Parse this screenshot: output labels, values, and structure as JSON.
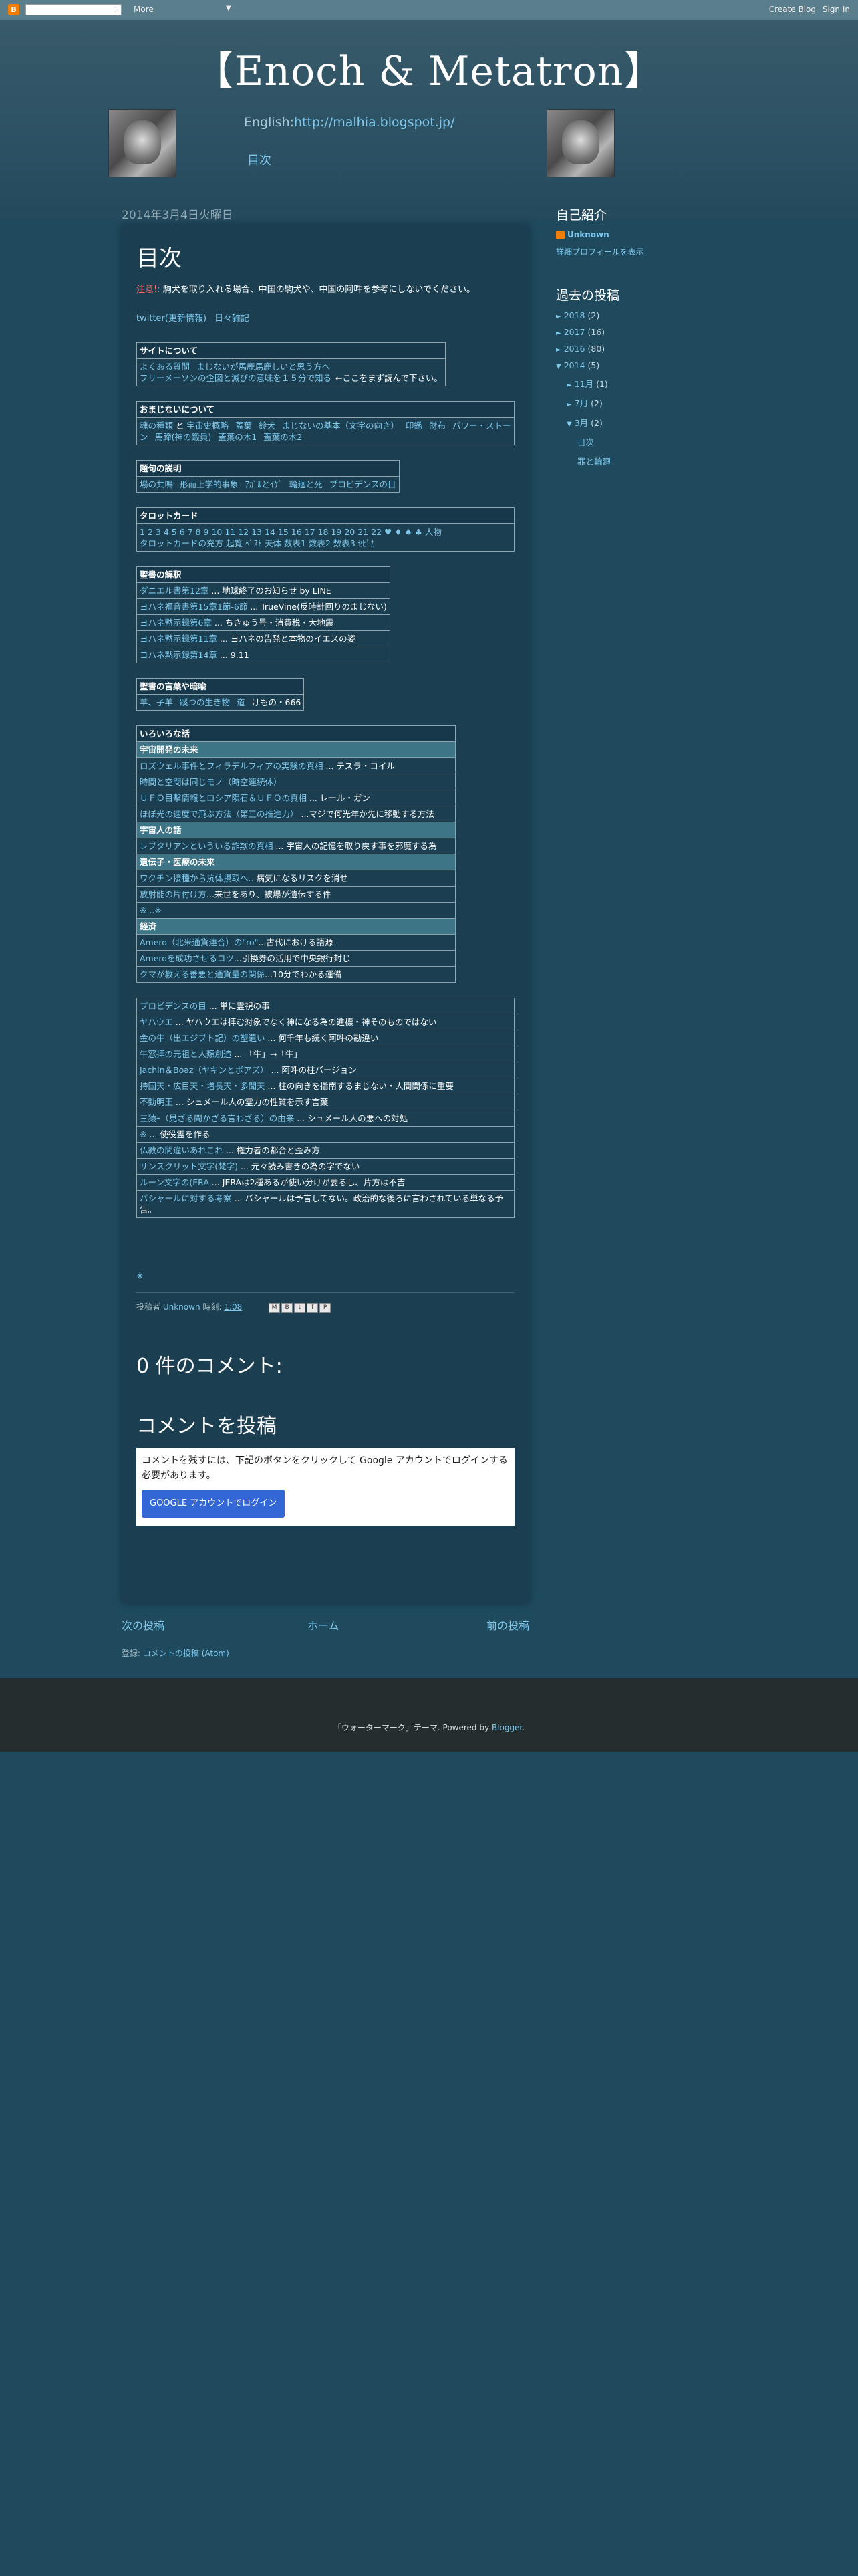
{
  "navbar": {
    "logo": "B",
    "more": "More",
    "create_blog": "Create Blog",
    "sign_in": "Sign In"
  },
  "header": {
    "title": "【Enoch & Metatron】",
    "english_label": "English:",
    "english_url": "http://malhia.blogspot.jp/",
    "toc_link": "目次"
  },
  "post": {
    "date": "2014年3月4日火曜日",
    "title": "目次",
    "note_label": "注意!:",
    "note_text": "駒犬を取り入れる場合、中国の駒犬や、中国の阿吽を参考にしないでください。",
    "twitter": [
      "twitter(更新情報)",
      "日々雑記"
    ],
    "sections": {
      "site": {
        "header": "サイトについて",
        "row1": [
          "よくある質問",
          "まじないが馬鹿馬鹿しいと思う方へ"
        ],
        "row2_link": "フリーメーソンの企図と滅びの意味を１５分で知る",
        "row2_text": "←ここをまず読んで下さい。"
      },
      "majinai": {
        "header": "おまじないについて",
        "row1": [
          "魂の種類",
          "と",
          "宇宙史概略",
          "蓋葉",
          "鈴犬",
          "まじないの基本（文字の向き）",
          "印鑑",
          "財布",
          "パワー・ストーン",
          "馬蹄(神の鍛員)",
          "蓋葉の木1",
          "蓋葉の木2"
        ]
      },
      "setsumei": {
        "header": "題句の説明",
        "row1": [
          "場の共鳴",
          "形而上学的事象",
          "ｱｶﾞﾙとｲｹﾞ",
          "輪廻と死",
          "プロビデンスの目"
        ]
      },
      "tarot": {
        "header": "タロットカード",
        "numbers": [
          "1",
          "2",
          "3",
          "4",
          "5",
          "6",
          "7",
          "8",
          "9",
          "10",
          "11",
          "12",
          "13",
          "14",
          "15",
          "16",
          "17",
          "18",
          "19",
          "20",
          "21",
          "22",
          "♥",
          "♦",
          "♠",
          "♣",
          "人物"
        ],
        "row2": [
          "タロットカードの充方",
          "起覧",
          "ﾍﾞｽﾄ",
          "天体",
          "数表1",
          "数表2",
          "数表3",
          "ｾﾋﾟｶ"
        ]
      },
      "bible": {
        "header": "聖書の解釈",
        "rows": [
          {
            "link": "ダニエル書第12章",
            "text": " ... 地球終了のお知らせ by LINE"
          },
          {
            "link": "ヨハネ福音書第15章1節-6節",
            "text": " ... TrueVine(反時計回りのまじない)"
          },
          {
            "link": "ヨハネ黙示録第6章",
            "text": " ... ちきゅう号・消費税・大地震"
          },
          {
            "link": "ヨハネ黙示録第11章",
            "text": " ... ヨハネの告発と本物のイエスの姿"
          },
          {
            "link": "ヨハネ黙示録第14章",
            "text": " ... 9.11"
          }
        ]
      },
      "words": {
        "header": "聖書の言葉や暗喩",
        "row1": [
          "羊、子羊",
          "蹊つの生き物",
          "道"
        ],
        "row1_text": "けもの・666"
      },
      "topics": {
        "header": "いろいろな話",
        "sub1": "宇宙開発の未来",
        "rows1": [
          {
            "link": "ロズウェル事件とフィラデルフィアの実験の真相",
            "text": " ... テスラ・コイル"
          },
          {
            "link": "時間と空間は同じモノ（時空連続体）",
            "text": ""
          },
          {
            "link": "ＵＦＯ目撃情報とロシア隕石＆ＵＦＯの真相",
            "text": " ... レール・ガン"
          },
          {
            "link": "ほぼ光の速度で飛ぶ方法（第三の推進力）",
            "text": " ...マジで何光年か先に移動する方法"
          }
        ],
        "sub2": "宇宙人の話",
        "rows2": [
          {
            "link": "レプタリアンといういる詐欺の真相",
            "text": " ... 宇宙人の記憶を取り戻す事を邪魔する為"
          }
        ],
        "sub3": "遺伝子・医療の未来",
        "rows3": [
          {
            "link": "ワクチン接種から抗体摂取へ...",
            "text": "病気になるリスクを消せ"
          },
          {
            "link": "放射能の片付け方",
            "text": "...来世をあり、被爆が遺伝する件"
          },
          {
            "link": "※...※",
            "text": ""
          }
        ],
        "sub4": "経済",
        "rows4": [
          {
            "link": "Amero（北米通貨連合）の\"ro\"",
            "text": "...古代における語源"
          },
          {
            "link": "Ameroを成功させるコツ",
            "text": "...引換券の活用で中央銀行封じ"
          },
          {
            "link": "クマが教える善悪と通貨量の関係",
            "text": "...10分でわかる運備"
          }
        ]
      },
      "misc": {
        "rows": [
          {
            "link": "プロビデンスの目",
            "text": " ... 単に霊視の事"
          },
          {
            "link": "ヤハウエ",
            "text": " ... ヤハウエは拝む対象でなく神になる為の進標・神そのものではない"
          },
          {
            "link": "金の牛（出エジプト記）の塑遺い",
            "text": " ... 何千年も続く阿吽の勘違い"
          },
          {
            "link": "牛窓拝の元祖と人類創造",
            "text": " ... 「牛」→「牛」"
          },
          {
            "link": "Jachin＆Boaz（ヤキンとボアズ）",
            "text": " ... 阿吽の柱バージョン"
          },
          {
            "link": "持国天・広目天・増長天・多聞天",
            "text": " ... 柱の向きを指南するまじない・人間関係に重要"
          },
          {
            "link": "不動明王",
            "text": " ... シュメール人の霊力の性質を示す言葉"
          },
          {
            "link": "三猿ｰ（見ざる聞かざる言わざる）の由来",
            "text": " ... シュメール人の悪への対処"
          },
          {
            "link": "※",
            "text": " ... 使役霊を作る"
          },
          {
            "link": "仏教の間違いあれこれ",
            "text": " ... 権力者の都合と歪み方"
          },
          {
            "link": "サンスクリット文字(梵字)",
            "text": " ... 元々読み書きの為の字でない"
          },
          {
            "link": "ルーン文字の(ERA",
            "text": " ... JERAは2種あるが使い分けが要るし、片方は不吉"
          },
          {
            "link": "バシャールに対する考察",
            "text": " ... バシャールは予言してない。政治的な後ろに言わされている単なる予告。"
          }
        ]
      }
    },
    "star": "※",
    "footer_label": "投稿者",
    "footer_author": "Unknown",
    "footer_time_label": "時刻:",
    "footer_time": "1:08",
    "share": [
      "M",
      "B",
      "t",
      "f",
      "P"
    ],
    "comments_count": "0 件のコメント:",
    "post_comment": "コメントを投稿",
    "comment_notice": "コメントを残すには、下記のボタンをクリックして Google アカウントでログインする必要があります。",
    "login_button": "GOOGLE アカウントでログイン"
  },
  "pager": {
    "newer": "次の投稿",
    "home": "ホーム",
    "older": "前の投稿"
  },
  "subscribe": {
    "label": "登録:",
    "link": "コメントの投稿 (Atom)"
  },
  "sidebar": {
    "profile_title": "自己紹介",
    "profile_name": "Unknown",
    "profile_link": "詳細プロフィールを表示",
    "archive_title": "過去の投稿",
    "archive": [
      {
        "tri": "►",
        "label": "2018",
        "count": "(2)",
        "indent": 0
      },
      {
        "tri": "►",
        "label": "2017",
        "count": "(16)",
        "indent": 0
      },
      {
        "tri": "►",
        "label": "2016",
        "count": "(80)",
        "indent": 0
      },
      {
        "tri": "▼",
        "label": "2014",
        "count": "(5)",
        "indent": 0
      },
      {
        "tri": "►",
        "label": "11月",
        "count": "(1)",
        "indent": 1
      },
      {
        "tri": "►",
        "label": "7月",
        "count": "(2)",
        "indent": 1
      },
      {
        "tri": "▼",
        "label": "3月",
        "count": "(2)",
        "indent": 1
      },
      {
        "tri": "",
        "label": "目次",
        "count": "",
        "indent": 2
      },
      {
        "tri": "",
        "label": "罪と輪廻",
        "count": "",
        "indent": 2
      }
    ]
  },
  "footer": {
    "attribution": "「ウォーターマーク」テーマ. Powered by ",
    "blogger": "Blogger",
    "period": "."
  },
  "colors": {
    "background": "#1f4a5e",
    "post_bg": "#1b3f51",
    "link": "#7fc8ec",
    "navbar": "#5b7e8c",
    "footer": "#252e2f"
  }
}
